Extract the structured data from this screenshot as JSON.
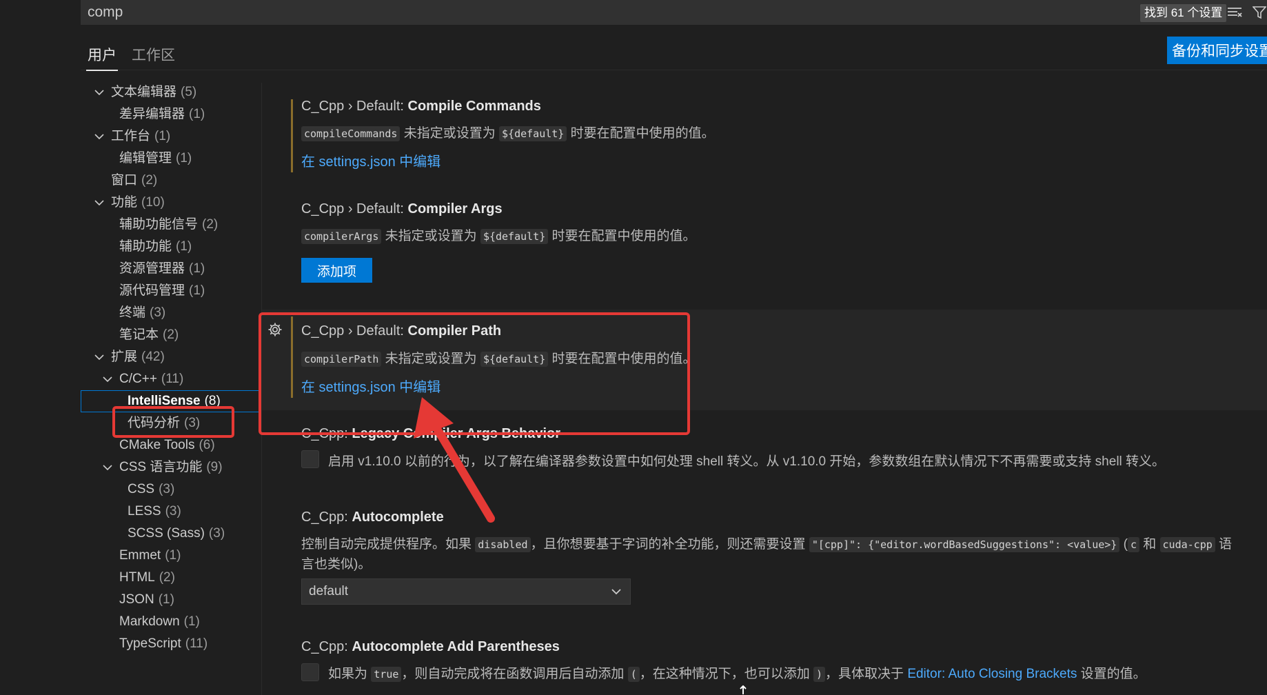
{
  "search": {
    "value": "comp",
    "result_count": "找到 61 个设置"
  },
  "tabs": [
    {
      "label": "用户"
    },
    {
      "label": "工作区"
    }
  ],
  "backup_sync_label": "备份和同步设置",
  "toc": [
    {
      "label": "文本编辑器",
      "count": "(5)"
    },
    {
      "label": "差异编辑器",
      "count": "(1)"
    },
    {
      "label": "工作台",
      "count": "(1)"
    },
    {
      "label": "编辑管理",
      "count": "(1)"
    },
    {
      "label": "窗口",
      "count": "(2)"
    },
    {
      "label": "功能",
      "count": "(10)"
    },
    {
      "label": "辅助功能信号",
      "count": "(2)"
    },
    {
      "label": "辅助功能",
      "count": "(1)"
    },
    {
      "label": "资源管理器",
      "count": "(1)"
    },
    {
      "label": "源代码管理",
      "count": "(1)"
    },
    {
      "label": "终端",
      "count": "(3)"
    },
    {
      "label": "笔记本",
      "count": "(2)"
    },
    {
      "label": "扩展",
      "count": "(42)"
    },
    {
      "label": "C/C++",
      "count": "(11)"
    },
    {
      "label": "IntelliSense",
      "count": "(8)"
    },
    {
      "label": "代码分析",
      "count": "(3)"
    },
    {
      "label": "CMake Tools",
      "count": "(6)"
    },
    {
      "label": "CSS 语言功能",
      "count": "(9)"
    },
    {
      "label": "CSS",
      "count": "(3)"
    },
    {
      "label": "LESS",
      "count": "(3)"
    },
    {
      "label": "SCSS (Sass)",
      "count": "(3)"
    },
    {
      "label": "Emmet",
      "count": "(1)"
    },
    {
      "label": "HTML",
      "count": "(2)"
    },
    {
      "label": "JSON",
      "count": "(1)"
    },
    {
      "label": "Markdown",
      "count": "(1)"
    },
    {
      "label": "TypeScript",
      "count": "(11)"
    }
  ],
  "settings": {
    "compile_commands": {
      "category": "C_Cpp › Default: ",
      "name": "Compile Commands",
      "code1": "compileCommands",
      "desc1": " 未指定或设置为 ",
      "code2": "${default}",
      "desc2": " 时要在配置中使用的值。",
      "link": "在 settings.json 中编辑"
    },
    "compiler_args": {
      "category": "C_Cpp › Default: ",
      "name": "Compiler Args",
      "code1": "compilerArgs",
      "desc1": " 未指定或设置为 ",
      "code2": "${default}",
      "desc2": " 时要在配置中使用的值。",
      "button": "添加项"
    },
    "compiler_path": {
      "category": "C_Cpp › Default: ",
      "name": "Compiler Path",
      "code1": "compilerPath",
      "desc1": " 未指定或设置为 ",
      "code2": "${default}",
      "desc2": " 时要在配置中使用的值。",
      "link": "在 settings.json 中编辑"
    },
    "legacy_args": {
      "category": "C_Cpp: ",
      "name": "Legacy Compiler Args Behavior",
      "desc": "启用 v1.10.0 以前的行为，以了解在编译器参数设置中如何处理 shell 转义。从 v1.10.0 开始，参数数组在默认情况下不再需要或支持 shell 转义。"
    },
    "autocomplete": {
      "category": "C_Cpp: ",
      "name": "Autocomplete",
      "desc_a": "控制自动完成提供程序。如果 ",
      "code_a": "disabled",
      "desc_b": "，且你想要基于字词的补全功能，则还需要设置 ",
      "code_b": "\"[cpp]\": {\"editor.wordBasedSuggestions\": <value>}",
      "desc_c": " (",
      "code_c": "c",
      "desc_d": " 和 ",
      "code_d": "cuda-cpp",
      "desc_e": " 语",
      "desc_line2": "言也类似)。",
      "dropdown_value": "default"
    },
    "autocomplete_parens": {
      "category": "C_Cpp: ",
      "name": "Autocomplete Add Parentheses",
      "desc_a": "如果为 ",
      "code_a": "true",
      "desc_b": "，则自动完成将在函数调用后自动添加 ",
      "code_b": "(",
      "desc_c": "，在这种情况下，也可以添加 ",
      "code_c": ")",
      "desc_d": "，具体取决于 ",
      "link": "Editor: Auto Closing Brackets",
      "desc_e": " 设置的值。"
    }
  },
  "colors": {
    "accent": "#0078d4",
    "link": "#4daafc",
    "annotation": "#e53935",
    "modified_bar": "#8a6d2b"
  }
}
